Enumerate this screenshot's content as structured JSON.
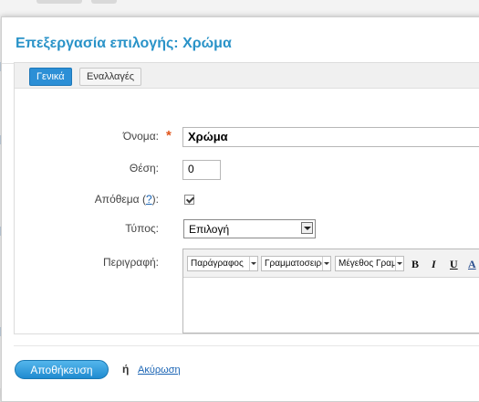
{
  "dialog": {
    "title": "Επεξεργασία επιλογής: Χρώμα"
  },
  "tabs": [
    {
      "label": "Γενικά",
      "active": true
    },
    {
      "label": "Εναλλαγές",
      "active": false
    }
  ],
  "form": {
    "name_label": "Όνομα:",
    "name_value": "Χρώμα",
    "position_label": "Θέση:",
    "position_value": "0",
    "stock_label": "Απόθεμα",
    "stock_help": "?",
    "stock_checked": true,
    "type_label": "Τύπος:",
    "type_value": "Επιλογή",
    "description_label": "Περιγραφή:"
  },
  "editor": {
    "format_select": "Παράγραφος",
    "font_select": "Γραμματοσειρά",
    "size_select": "Μέγεθος Γραμματοσειράς",
    "bold": "B",
    "italic": "I",
    "underline": "U",
    "color": "A"
  },
  "footer": {
    "save_label": "Αποθήκευση",
    "or_text": "ή",
    "cancel_label": "Ακύρωση"
  },
  "colors": {
    "accent": "#2a93c8",
    "tab_active": "#2c8fd6",
    "required": "#e1561c",
    "link": "#1a64b4"
  }
}
